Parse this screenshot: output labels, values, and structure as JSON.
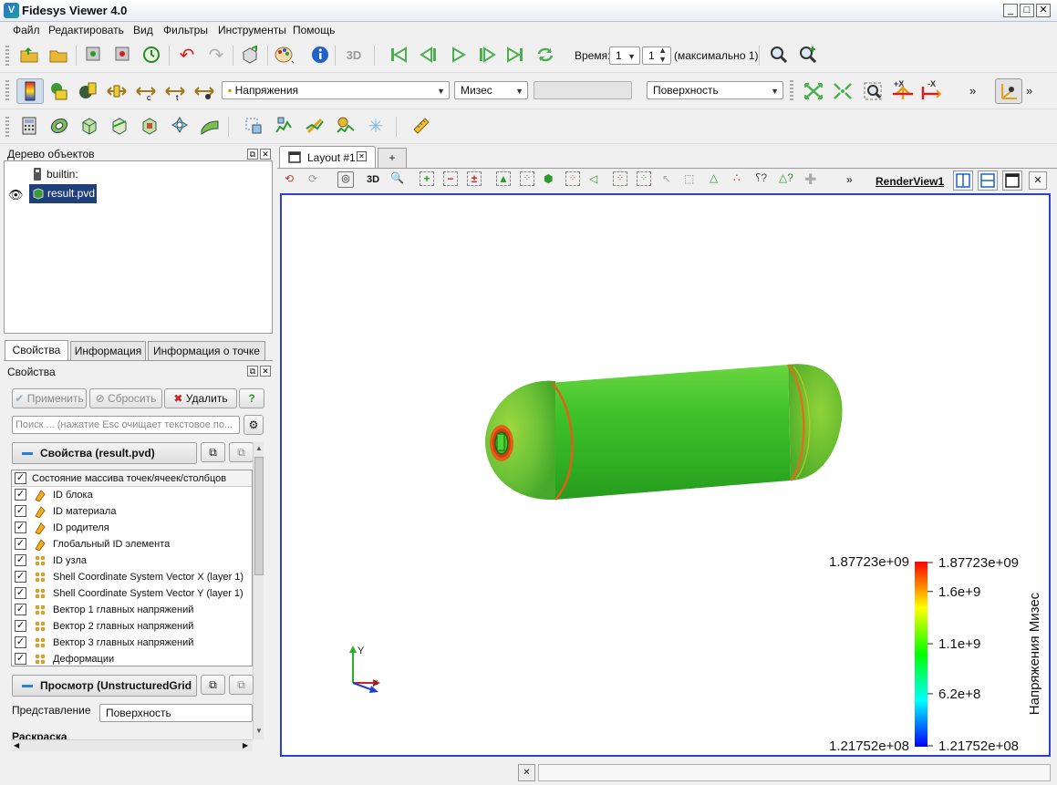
{
  "window": {
    "title": "Fidesys Viewer 4.0",
    "min": "_",
    "max": "□",
    "close": "✕"
  },
  "menu": [
    "Файл",
    "Редактировать",
    "Вид",
    "Фильтры",
    "Инструменты",
    "Помощь"
  ],
  "toolbar1": {
    "time_label": "Время:",
    "time_value": "1",
    "time_index": "1",
    "max_label": "(максимально 1)",
    "three_d": "3D"
  },
  "toolbar2": {
    "field_combo": "Напряжения",
    "component_combo": "Мизес",
    "blank_combo": "",
    "representation_combo": "Поверхность",
    "overflow": "»",
    "plus_x": "+X",
    "minus_x": "-X"
  },
  "pipeline": {
    "title": "Дерево объектов",
    "items": [
      {
        "label": "builtin:"
      },
      {
        "label": "result.pvd"
      }
    ]
  },
  "tabs": [
    "Свойства",
    "Информация",
    "Информация о точке"
  ],
  "properties": {
    "title": "Свойства",
    "apply": "Применить",
    "reset": "Сбросить",
    "delete": "Удалить",
    "help": "?",
    "search_placeholder": "Поиск ... (нажатие Esc очищает текстовое по...",
    "section_props": "Свойства (result.pvd)",
    "array_header": "Состояние массива точек/ячеек/столбцов",
    "arrays": [
      {
        "label": "ID блока",
        "kind": "cell"
      },
      {
        "label": "ID материала",
        "kind": "cell"
      },
      {
        "label": "ID родителя",
        "kind": "cell"
      },
      {
        "label": "Глобальный ID элемента",
        "kind": "cell"
      },
      {
        "label": "ID узла",
        "kind": "point"
      },
      {
        "label": "Shell Coordinate System Vector X (layer 1)",
        "kind": "point"
      },
      {
        "label": "Shell Coordinate System Vector Y (layer 1)",
        "kind": "point"
      },
      {
        "label": "Вектор 1 главных напряжений",
        "kind": "point"
      },
      {
        "label": "Вектор 2 главных напряжений",
        "kind": "point"
      },
      {
        "label": "Вектор 3 главных напряжений",
        "kind": "point"
      },
      {
        "label": "Деформации",
        "kind": "point"
      }
    ],
    "section_view": "Просмотр (UnstructuredGrid",
    "representation_label": "Представление",
    "representation_value": "Поверхность",
    "coloring_label": "Раскраска"
  },
  "layout": {
    "tab_label": "Layout #1",
    "add_tab": "+",
    "renderview_label": "RenderView1",
    "three_d": "3D"
  },
  "colorbar": {
    "title": "Напряжения Мизес",
    "max_left": "1.87723e+09",
    "min_left": "1.21752e+08",
    "ticks": [
      {
        "label": "1.87723e+09",
        "frac": 1.0
      },
      {
        "label": "1.6e+9",
        "frac": 0.842
      },
      {
        "label": "1.1e+9",
        "frac": 0.557
      },
      {
        "label": "6.2e+8",
        "frac": 0.284
      },
      {
        "label": "1.21752e+08",
        "frac": 0.0
      }
    ],
    "colors": [
      "#0000ff",
      "#00ffff",
      "#00ff00",
      "#ffff00",
      "#ff0000"
    ]
  },
  "axes": {
    "y_label": "Y"
  },
  "colors": {
    "model_green": "#4fcc2c",
    "band_orange": "#e06018",
    "render_border": "#2b3fd0",
    "selection": "#1f3f7a"
  }
}
